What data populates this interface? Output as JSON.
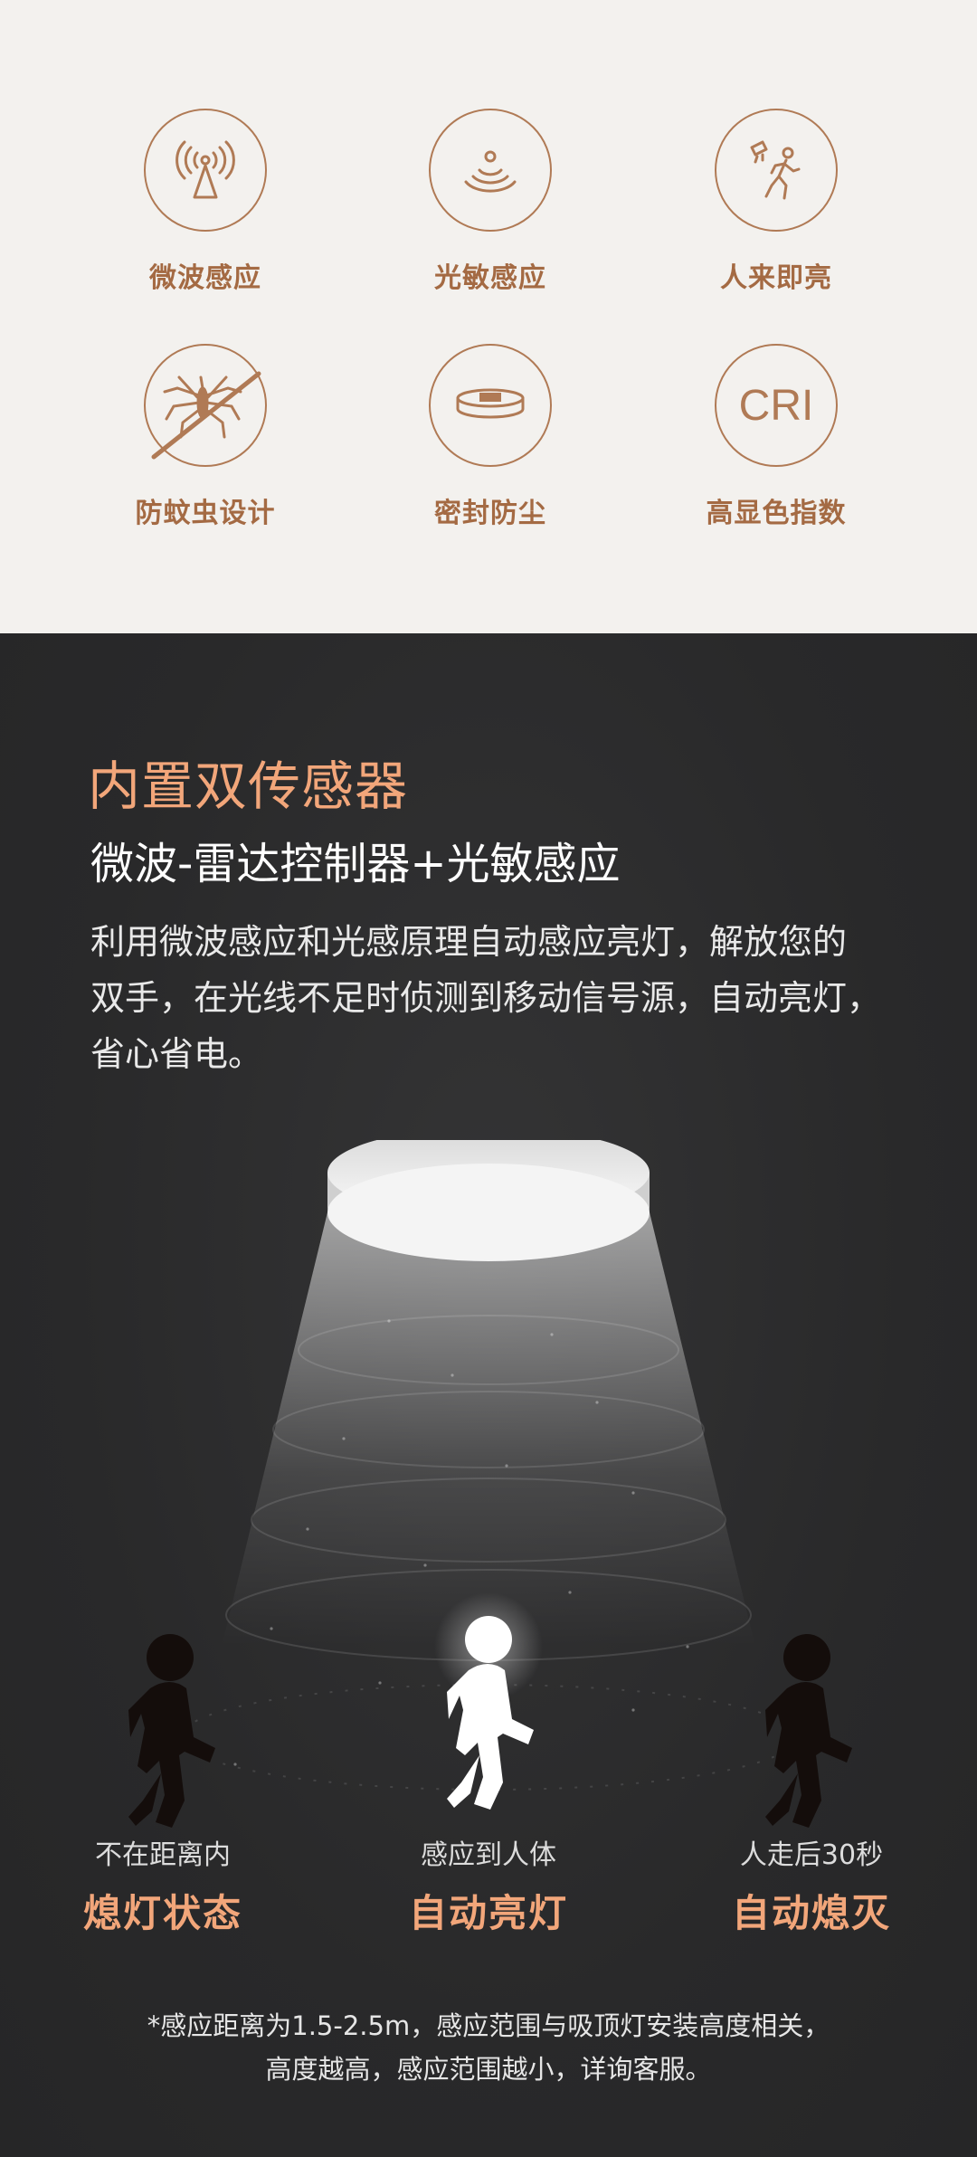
{
  "features": [
    {
      "icon": "microwave-sensor-icon",
      "label": "微波感应"
    },
    {
      "icon": "light-sensor-icon",
      "label": "光敏感应"
    },
    {
      "icon": "person-light-icon",
      "label": "人来即亮"
    },
    {
      "icon": "mosquito-block-icon",
      "label": "防蚊虫设计"
    },
    {
      "icon": "sealed-dustproof-icon",
      "label": "密封防尘"
    },
    {
      "icon": "cri-icon",
      "label": "高显色指数",
      "icon_text": "CRI"
    }
  ],
  "section": {
    "heading": "内置双传感器",
    "subheading": "微波-雷达控制器+光敏感应",
    "description_lines": [
      "利用微波感应和光感原理自动感应亮灯，解放您的",
      "双手，在光线不足时侦测到移动信号源，自动亮灯，",
      "省心省电。"
    ]
  },
  "states": [
    {
      "small": "不在距离内",
      "big": "熄灯状态",
      "figure": "dark"
    },
    {
      "small": "感应到人体",
      "big": "自动亮灯",
      "figure": "lit"
    },
    {
      "small": "人走后30秒",
      "big": "自动熄灭",
      "figure": "dark"
    }
  ],
  "note_lines": [
    "*感应距离为1.5-2.5m，感应范围与吸顶灯安装高度相关，",
    "高度越高，感应范围越小，详询客服。"
  ],
  "colors": {
    "accent_orange": "#f2a67a",
    "icon_brown": "#b07a55",
    "label_brown": "#a46a43",
    "light_bg": "#f3f1ee",
    "dark_bg": "#2a2a2b"
  }
}
